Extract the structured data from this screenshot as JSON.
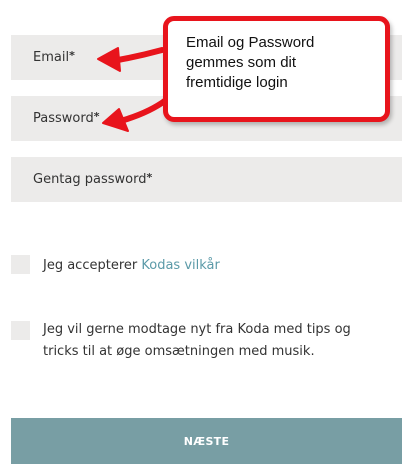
{
  "form": {
    "fields": [
      {
        "label": "Email",
        "required_mark": "*"
      },
      {
        "label": "Password",
        "required_mark": "*"
      },
      {
        "label": "Gentag password",
        "required_mark": "*"
      }
    ],
    "terms_checkbox": {
      "text": "Jeg accepterer ",
      "link_text": "Kodas vilkår",
      "checked": false
    },
    "newsletter_checkbox": {
      "line1": "Jeg vil gerne modtage nyt fra Koda med tips og",
      "line2": "tricks til at øge omsætningen med musik.",
      "checked": false
    },
    "next_button": "NÆSTE"
  },
  "annotation": {
    "lines": [
      "Email og Password",
      "gemmes som dit",
      "fremtidige login"
    ],
    "color": "#e8141c"
  },
  "colors": {
    "field_bg": "#ecebea",
    "button_bg": "#789ea4",
    "link": "#5b9aa8"
  }
}
